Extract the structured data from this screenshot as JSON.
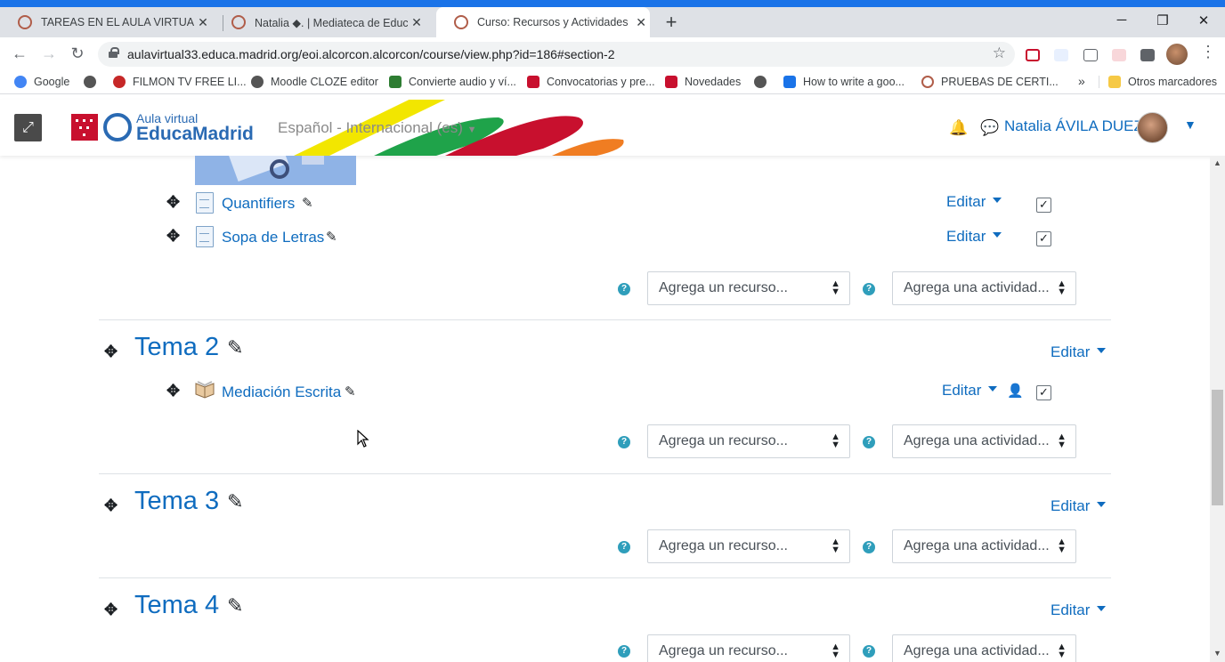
{
  "browser": {
    "tabs": [
      {
        "title": "TAREAS EN EL AULA VIRTUAL: Cr",
        "active": false
      },
      {
        "title": "Natalia ◆. | Mediateca de Educa",
        "active": false
      },
      {
        "title": "Curso: Recursos y Actividades",
        "active": true
      }
    ],
    "url": "aulavirtual33.educa.madrid.org/eoi.alcorcon.alcorcon/course/view.php?id=186#section-2",
    "bookmarks": [
      {
        "label": "Google",
        "color": "#4285f4"
      },
      {
        "label": "FILMON TV FREE LI...",
        "color": "#c62828"
      },
      {
        "label": "Moodle CLOZE editor",
        "color": "#555555"
      },
      {
        "label": "Convierte audio y ví...",
        "color": "#2e7d32"
      },
      {
        "label": "Convocatorias y pre...",
        "color": "#c8102e"
      },
      {
        "label": "Novedades",
        "color": "#c8102e"
      },
      {
        "label": "How to write a goo...",
        "color": "#1a73e8"
      },
      {
        "label": "PRUEBAS DE CERTI...",
        "color": "#b05d49"
      }
    ],
    "more_bookmarks": "»",
    "other_bookmarks": "Otros marcadores"
  },
  "header": {
    "logo_line1": "Aula virtual",
    "logo_line2": "EducaMadrid",
    "language": "Español - Internacional (es)",
    "user_name": "Natalia ÁVILA DUEZ"
  },
  "activities_top": [
    {
      "name": "Quantifiers",
      "edit": "Editar"
    },
    {
      "name": "Sopa de Letras",
      "edit": "Editar"
    }
  ],
  "add_resource": "Agrega un recurso...",
  "add_activity": "Agrega una actividad...",
  "sections": [
    {
      "title": "Tema 2",
      "edit": "Editar",
      "activity": {
        "name": "Mediación Escrita",
        "edit": "Editar"
      }
    },
    {
      "title": "Tema 3",
      "edit": "Editar"
    },
    {
      "title": "Tema 4",
      "edit": "Editar"
    }
  ]
}
